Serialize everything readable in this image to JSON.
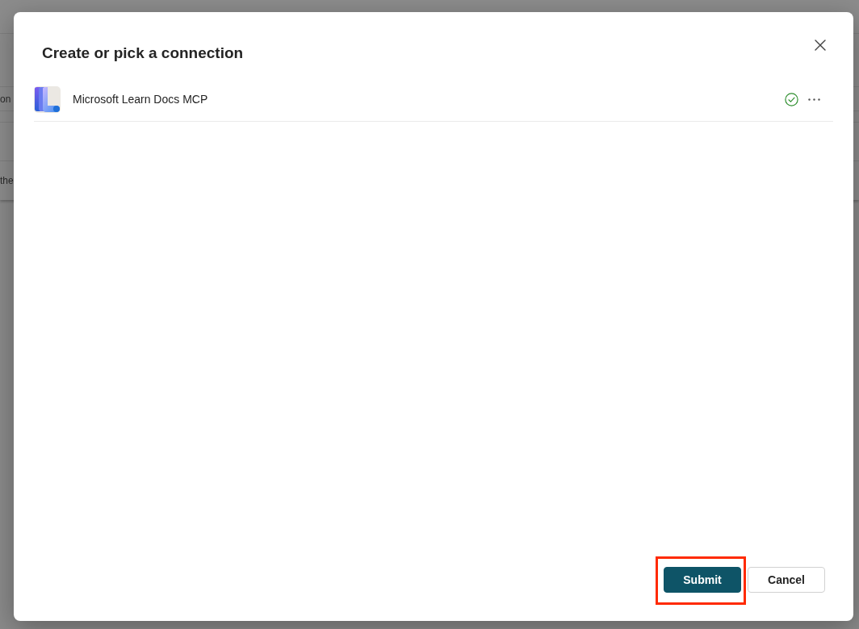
{
  "background": {
    "texts": [
      "on",
      "the"
    ]
  },
  "dialog": {
    "title": "Create or pick a connection",
    "connections": [
      {
        "name": "Microsoft Learn Docs MCP",
        "connected": true
      }
    ],
    "buttons": [
      {
        "label": "Submit",
        "kind": "primary",
        "highlighted": true
      },
      {
        "label": "Cancel",
        "kind": "secondary",
        "highlighted": false
      }
    ]
  }
}
